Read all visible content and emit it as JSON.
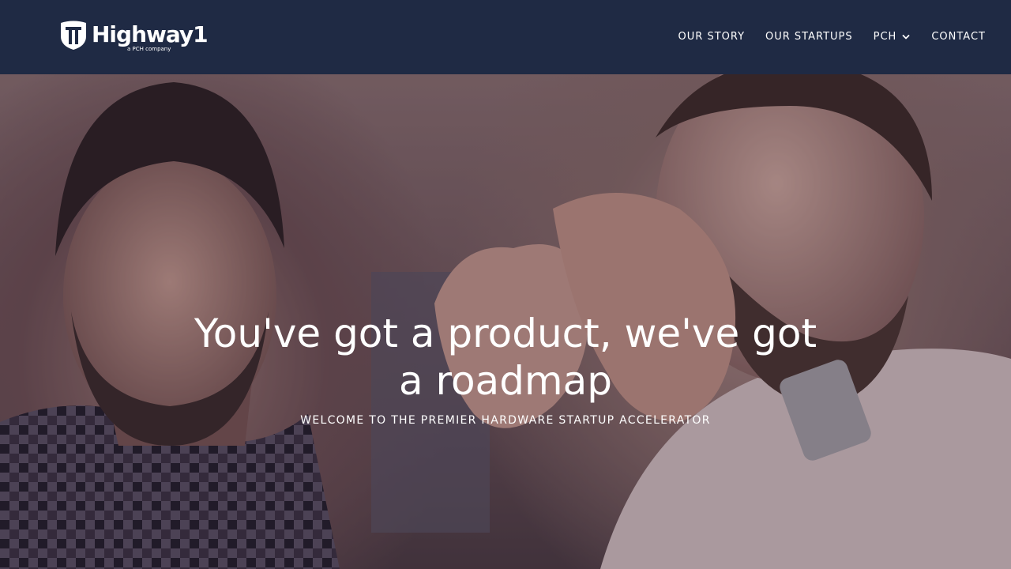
{
  "brand": {
    "name": "Highway1",
    "tagline": "a PCH company"
  },
  "nav": {
    "items": [
      {
        "label": "OUR STORY"
      },
      {
        "label": "OUR STARTUPS"
      },
      {
        "label": "PCH",
        "icon": "chevron-down-icon"
      },
      {
        "label": "CONTACT"
      }
    ]
  },
  "hero": {
    "title": "You've got a product, we've got a roadmap",
    "subtitle": "WELCOME TO THE PREMIER HARDWARE STARTUP ACCELERATOR"
  },
  "colors": {
    "navbar_bg": "#1f2a44",
    "text": "#ffffff"
  }
}
